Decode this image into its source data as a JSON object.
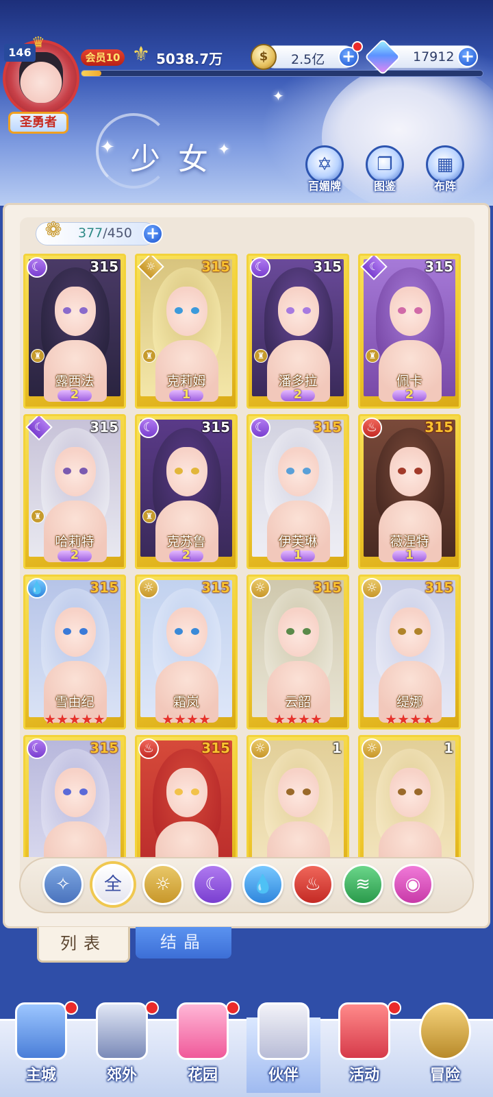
{
  "colors": {
    "accent": "#2d55b0",
    "card_gold": "#f3d33a",
    "star_red": "#e5322a",
    "wing_purple": "#9d5fe0",
    "panel_bg": "#f6efe6"
  },
  "header": {
    "player_level": "146",
    "player_title": "圣勇者",
    "vip_label": "会员10",
    "power_value": "5038.7万",
    "exp_fraction": 0.05,
    "gold_value": "2.5亿",
    "gem_value": "17912",
    "icons": [
      "crown-icon",
      "power-icon",
      "coin-icon",
      "gem-icon",
      "plus-icon"
    ]
  },
  "banner": {
    "title": "少女",
    "buttons": [
      {
        "label": "百媚牌",
        "icon": "cards-icon"
      },
      {
        "label": "图鉴",
        "icon": "book-icon"
      },
      {
        "label": "布阵",
        "icon": "grid-icon"
      }
    ]
  },
  "roster": {
    "count_current": "377",
    "count_max": "/450"
  },
  "cards": [
    {
      "name": "露西法",
      "level": "315",
      "element": "moon",
      "wings": "2",
      "stars": 0
    },
    {
      "name": "克莉姆",
      "level": "315",
      "element": "sun",
      "wings": "1",
      "stars": 0
    },
    {
      "name": "潘多拉",
      "level": "315",
      "element": "moon",
      "wings": "2",
      "stars": 0
    },
    {
      "name": "佩卡",
      "level": "315",
      "element": "moon",
      "wings": "2",
      "stars": 0
    },
    {
      "name": "哈莉特",
      "level": "315",
      "element": "moon",
      "wings": "2",
      "stars": 0
    },
    {
      "name": "克苏鲁",
      "level": "315",
      "element": "moon",
      "wings": "2",
      "stars": 0
    },
    {
      "name": "伊芙琳",
      "level": "315",
      "element": "moon",
      "wings": "1",
      "stars": 0
    },
    {
      "name": "薇涅特",
      "level": "315",
      "element": "fire",
      "wings": "1",
      "stars": 0
    },
    {
      "name": "雪由纪",
      "level": "315",
      "element": "water",
      "wings": "",
      "stars": 5
    },
    {
      "name": "霜岚",
      "level": "315",
      "element": "sun",
      "wings": "",
      "stars": 4
    },
    {
      "name": "云韶",
      "level": "315",
      "element": "sun",
      "wings": "",
      "stars": 4
    },
    {
      "name": "缇娜",
      "level": "315",
      "element": "sun",
      "wings": "",
      "stars": 4
    },
    {
      "name": "",
      "level": "315",
      "element": "moon",
      "wings": "",
      "stars": 0
    },
    {
      "name": "",
      "level": "315",
      "element": "fire",
      "wings": "",
      "stars": 0
    },
    {
      "name": "",
      "level": "1",
      "element": "sun",
      "wings": "",
      "stars": 0
    },
    {
      "name": "",
      "level": "1",
      "element": "sun",
      "wings": "",
      "stars": 0
    }
  ],
  "filters": [
    {
      "id": "star",
      "label": "",
      "icon": "star-filter-icon"
    },
    {
      "id": "all",
      "label": "全",
      "icon": "all-filter-icon",
      "selected": true
    },
    {
      "id": "sun",
      "label": "",
      "icon": "sun-filter-icon"
    },
    {
      "id": "moon",
      "label": "",
      "icon": "moon-filter-icon"
    },
    {
      "id": "water",
      "label": "",
      "icon": "water-filter-icon"
    },
    {
      "id": "fire",
      "label": "",
      "icon": "fire-filter-icon"
    },
    {
      "id": "wind",
      "label": "",
      "icon": "wind-filter-icon"
    },
    {
      "id": "void",
      "label": "",
      "icon": "void-filter-icon"
    }
  ],
  "tabs": {
    "list_label": "列表",
    "crystal_label": "结晶"
  },
  "nav": [
    {
      "label": "主城",
      "icon": "castle-icon",
      "dot": true
    },
    {
      "label": "郊外",
      "icon": "portal-icon",
      "dot": true
    },
    {
      "label": "花园",
      "icon": "heart-icon",
      "dot": true
    },
    {
      "label": "伙伴",
      "icon": "partner-icon",
      "active": true
    },
    {
      "label": "活动",
      "icon": "gift-icon",
      "dot": true
    },
    {
      "label": "冒险",
      "icon": "compass-icon"
    }
  ]
}
